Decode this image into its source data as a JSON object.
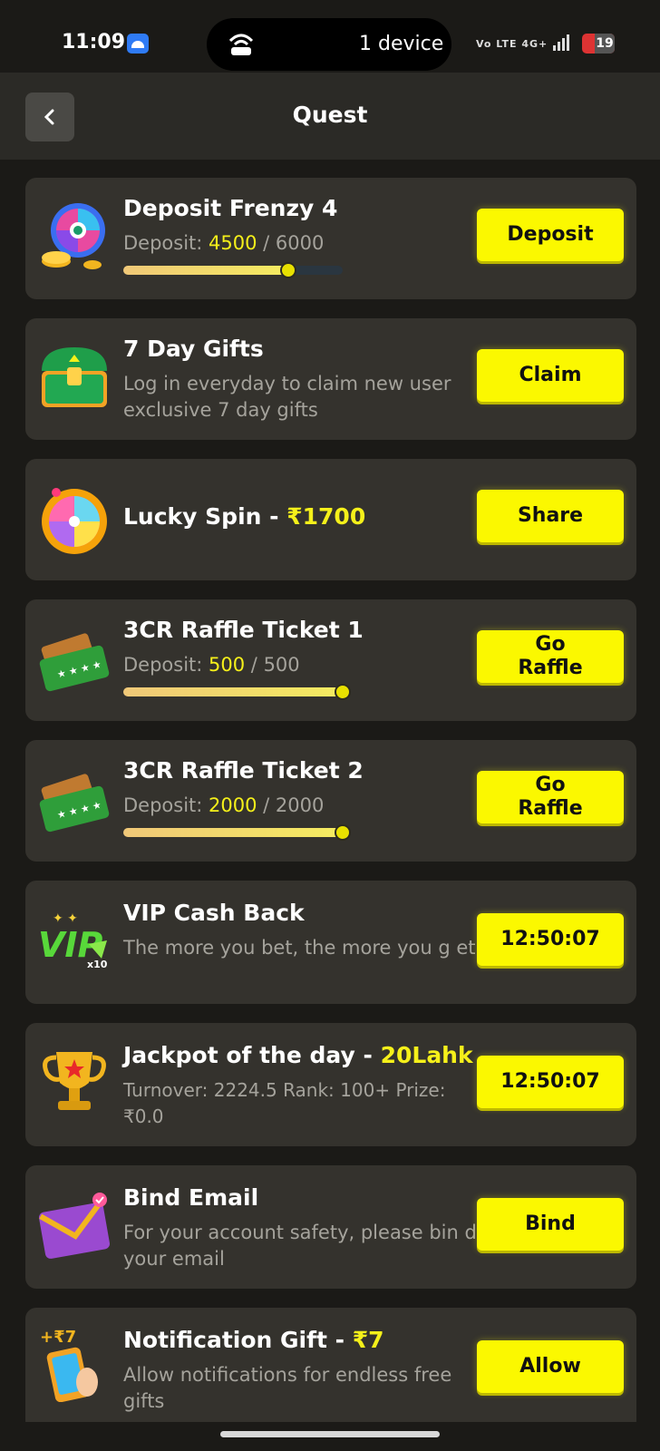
{
  "status_bar": {
    "time": "11:09",
    "hotspot_label": "1 device",
    "network_text": "Vo LTE  4G+",
    "battery": "19"
  },
  "header": {
    "back_icon": "chevron-left-icon",
    "title": "Quest"
  },
  "quests": [
    {
      "icon": "prize-wheel-coins-icon",
      "title": "Deposit Frenzy 4",
      "desc_prefix": "Deposit: ",
      "current": "4500",
      "separator": " / ",
      "target": "6000",
      "progress": 0.75,
      "button": "Deposit"
    },
    {
      "icon": "treasure-chest-icon",
      "title": "7 Day Gifts",
      "desc": "Log in everyday to claim new user exclusive 7 day gifts",
      "button": "Claim"
    },
    {
      "icon": "lucky-wheel-icon",
      "title_prefix": "Lucky Spin - ",
      "title_highlight": "₹1700",
      "button": "Share"
    },
    {
      "icon": "raffle-ticket-icon",
      "title": "3CR Raffle Ticket 1",
      "desc_prefix": "Deposit: ",
      "current": "500",
      "separator": " / ",
      "target": "500",
      "progress": 1.0,
      "button": "Go Raffle"
    },
    {
      "icon": "raffle-ticket-icon",
      "title": "3CR Raffle Ticket 2",
      "desc_prefix": "Deposit: ",
      "current": "2000",
      "separator": " / ",
      "target": "2000",
      "progress": 1.0,
      "button": "Go Raffle"
    },
    {
      "icon": "vip-badge-icon",
      "title": "VIP Cash Back",
      "desc": "The more you bet, the more you g et",
      "button": "12:50:07"
    },
    {
      "icon": "trophy-icon",
      "title_prefix": "Jackpot of the day - ",
      "title_highlight": "20Lahk",
      "desc": "Turnover: 2224.5 Rank: 100+ Prize: ₹0.0",
      "button": "12:50:07"
    },
    {
      "icon": "envelope-icon",
      "title": "Bind Email",
      "desc": "For your account safety, please bin d your email",
      "button": "Bind"
    },
    {
      "icon": "phone-notification-icon",
      "title_prefix": "Notification Gift - ",
      "title_highlight": "₹7",
      "desc": "Allow notifications for endless free gifts",
      "button": "Allow"
    }
  ],
  "colors": {
    "accent_yellow": "#fbf800",
    "highlight_text": "#f5f01a",
    "card_bg": "#34322d",
    "page_bg": "#1b1a17"
  }
}
